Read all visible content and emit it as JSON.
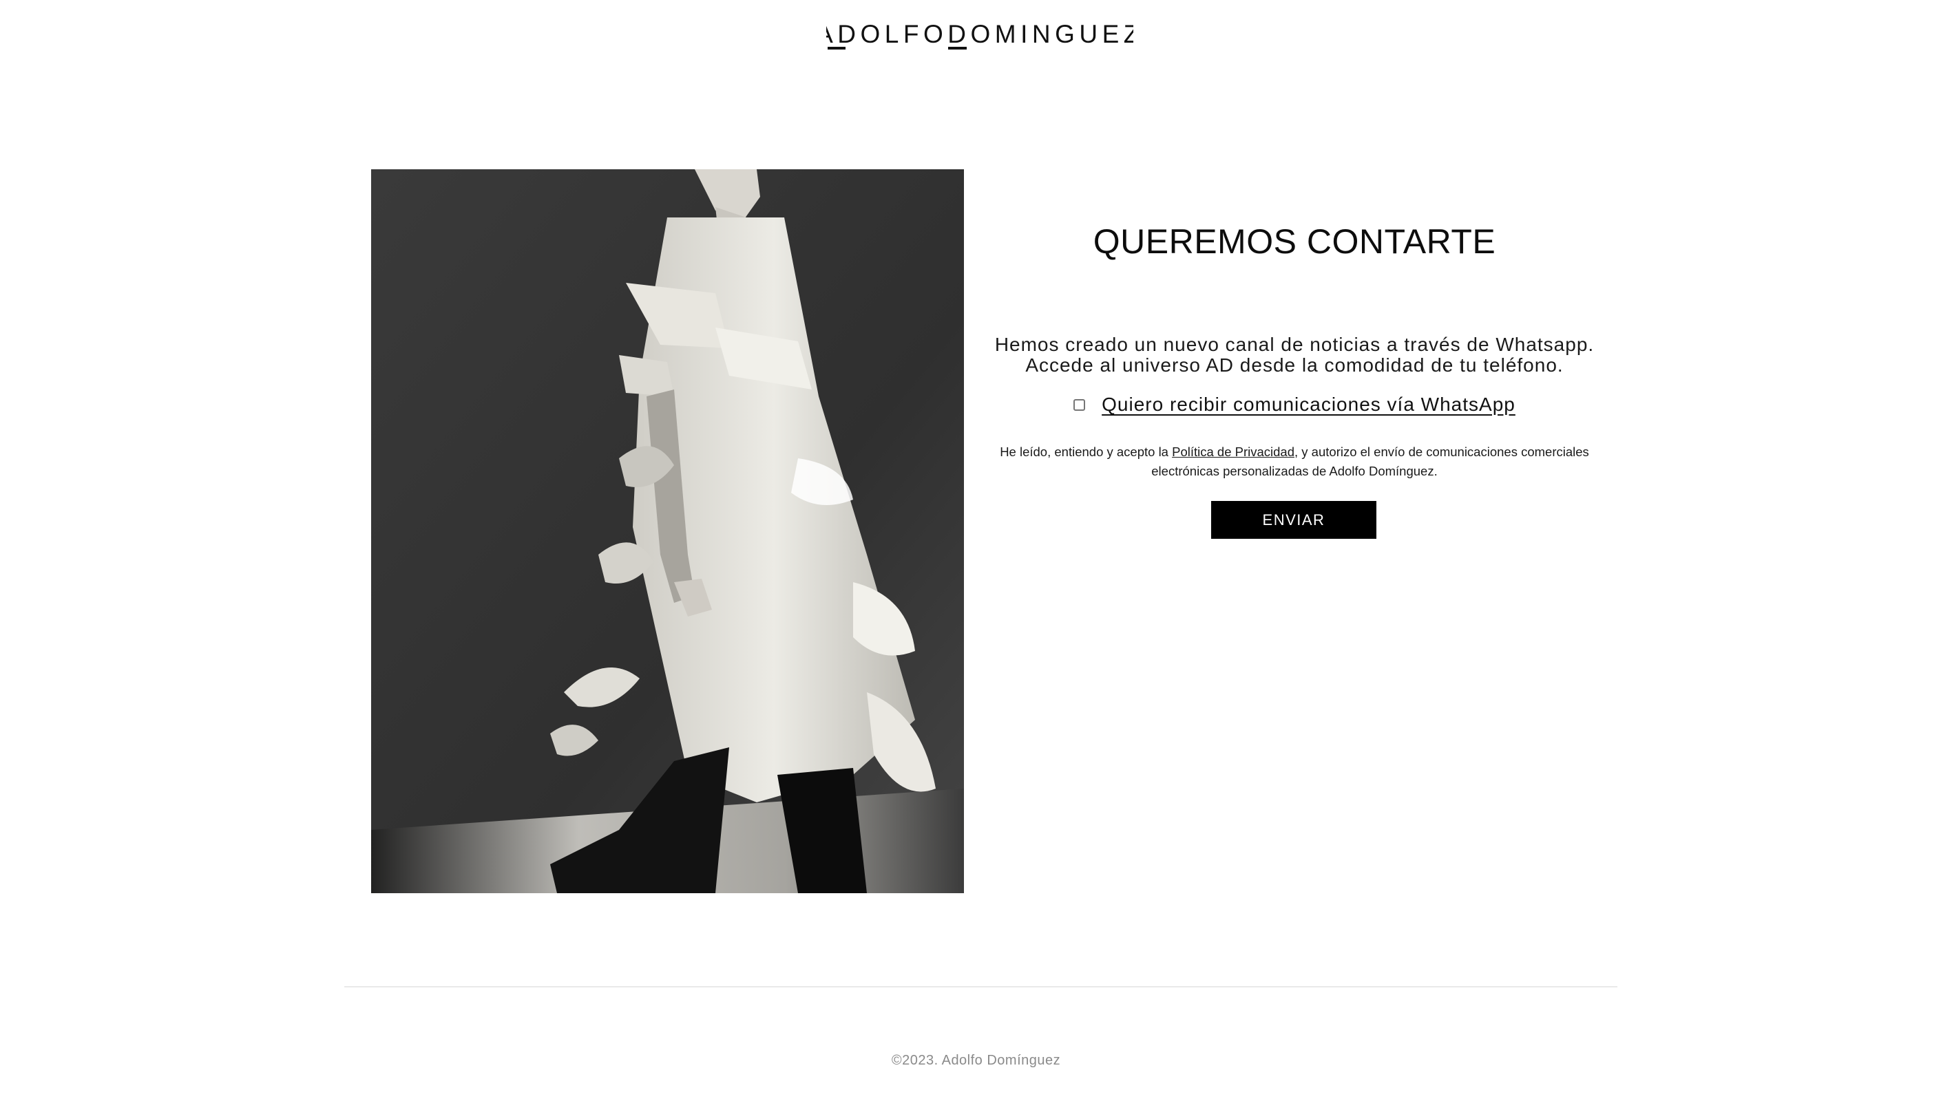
{
  "header": {
    "logo_text": "ADOLFODOMINGUEZ"
  },
  "main": {
    "title": "QUEREMOS CONTARTE",
    "intro_line1": "Hemos creado un nuevo canal de noticias a través de Whatsapp.",
    "intro_line2": "Accede al universo AD desde la comodidad de tu teléfono.",
    "optin": {
      "label": "Quiero recibir comunicaciones vía WhatsApp",
      "checked": false
    },
    "legal": {
      "before_link": "He leído, entiendo y acepto la ",
      "link_text": "Política de Privacidad",
      "after_link_line1": ", y autorizo el envío de comunicaciones comerciales",
      "line2": "electrónicas personalizadas de Adolfo Domínguez."
    },
    "submit_label": "ENVIAR"
  },
  "footer": {
    "copyright": "©2023. Adolfo Domínguez"
  },
  "colors": {
    "button_bg": "#000000",
    "button_text": "#ffffff",
    "footer_text": "#8a8a8a",
    "divider": "#e9e9e9"
  },
  "icons": {
    "logo": "adolfo-dominguez-wordmark"
  }
}
